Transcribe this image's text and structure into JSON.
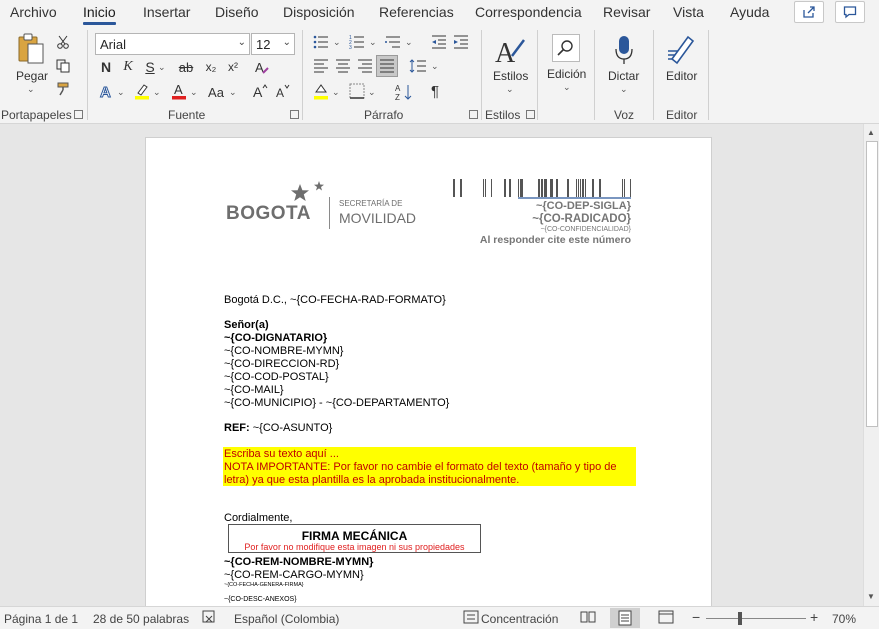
{
  "menu": {
    "tabs": [
      "Archivo",
      "Inicio",
      "Insertar",
      "Diseño",
      "Disposición",
      "Referencias",
      "Correspondencia",
      "Revisar",
      "Vista",
      "Ayuda"
    ],
    "active_tab": "Inicio"
  },
  "ribbon": {
    "clipboard": {
      "paste_label": "Pegar",
      "group_label": "Portapapeles"
    },
    "font": {
      "font_name": "Arial",
      "font_size": "12",
      "group_label": "Fuente",
      "bold": "N",
      "italic": "K",
      "underline": "S",
      "strike": "ab",
      "subscript": "x₂",
      "superscript": "x²",
      "change_case": "Aa",
      "grow": "A",
      "shrink": "A"
    },
    "paragraph": {
      "group_label": "Párrafo"
    },
    "styles": {
      "label": "Estilos",
      "group_label": "Estilos"
    },
    "editing": {
      "label": "Edición"
    },
    "voice": {
      "label": "Dictar",
      "group_label": "Voz"
    },
    "editor": {
      "label": "Editor",
      "group_label": "Editor"
    }
  },
  "document": {
    "logo": {
      "city": "BOGOTA",
      "secretaria": "SECRETARÍA DE",
      "movilidad": "MOVILIDAD"
    },
    "header_fields": {
      "dep_sigla": "~{CO-DEP-SIGLA}",
      "radicado": "~{CO-RADICADO}",
      "confidencialidad": "~{CO-CONFIDENCIALIDAD}",
      "cite": "Al responder cite este número"
    },
    "date_line": "Bogotá D.C., ~{CO-FECHA-RAD-FORMATO}",
    "salutation": "Señor(a)",
    "recipient": [
      "~{CO-DIGNATARIO}",
      "~{CO-NOMBRE-MYMN}",
      "~{CO-DIRECCION-RD}",
      "~{CO-COD-POSTAL}",
      "~{CO-MAIL}",
      "~{CO-MUNICIPIO} - ~{CO-DEPARTAMENTO}"
    ],
    "ref_label": "REF:",
    "ref_value": " ~{CO-ASUNTO}",
    "body_placeholder": "Escriba su texto aquí ...",
    "note_line1": "NOTA IMPORTANTE: Por favor no cambie el formato del texto (tamaño y tipo de",
    "note_line2": "letra) ya que esta plantilla es la aprobada institucionalmente.",
    "closing": "Cordialmente,",
    "signature_box": {
      "title": "FIRMA MECÁNICA",
      "subtitle": "Por favor no modifique esta imagen ni sus propiedades"
    },
    "sender_name": "~{CO-REM-NOMBRE-MYMN}",
    "sender_cargo": "~{CO-REM-CARGO-MYMN}",
    "fecha_firma": "~{CO-FECHA-GENERA-FIRMA}",
    "anexos": "~{CO-DESC-ANEXOS}"
  },
  "status": {
    "page": "Página 1 de 1",
    "words": "28 de 50 palabras",
    "language": "Español (Colombia)",
    "focus": "Concentración",
    "zoom": "70%"
  },
  "colors": {
    "accent": "#2b579a",
    "highlight": "#ffff00",
    "note_text": "#c00000",
    "grey_text": "#767676"
  }
}
